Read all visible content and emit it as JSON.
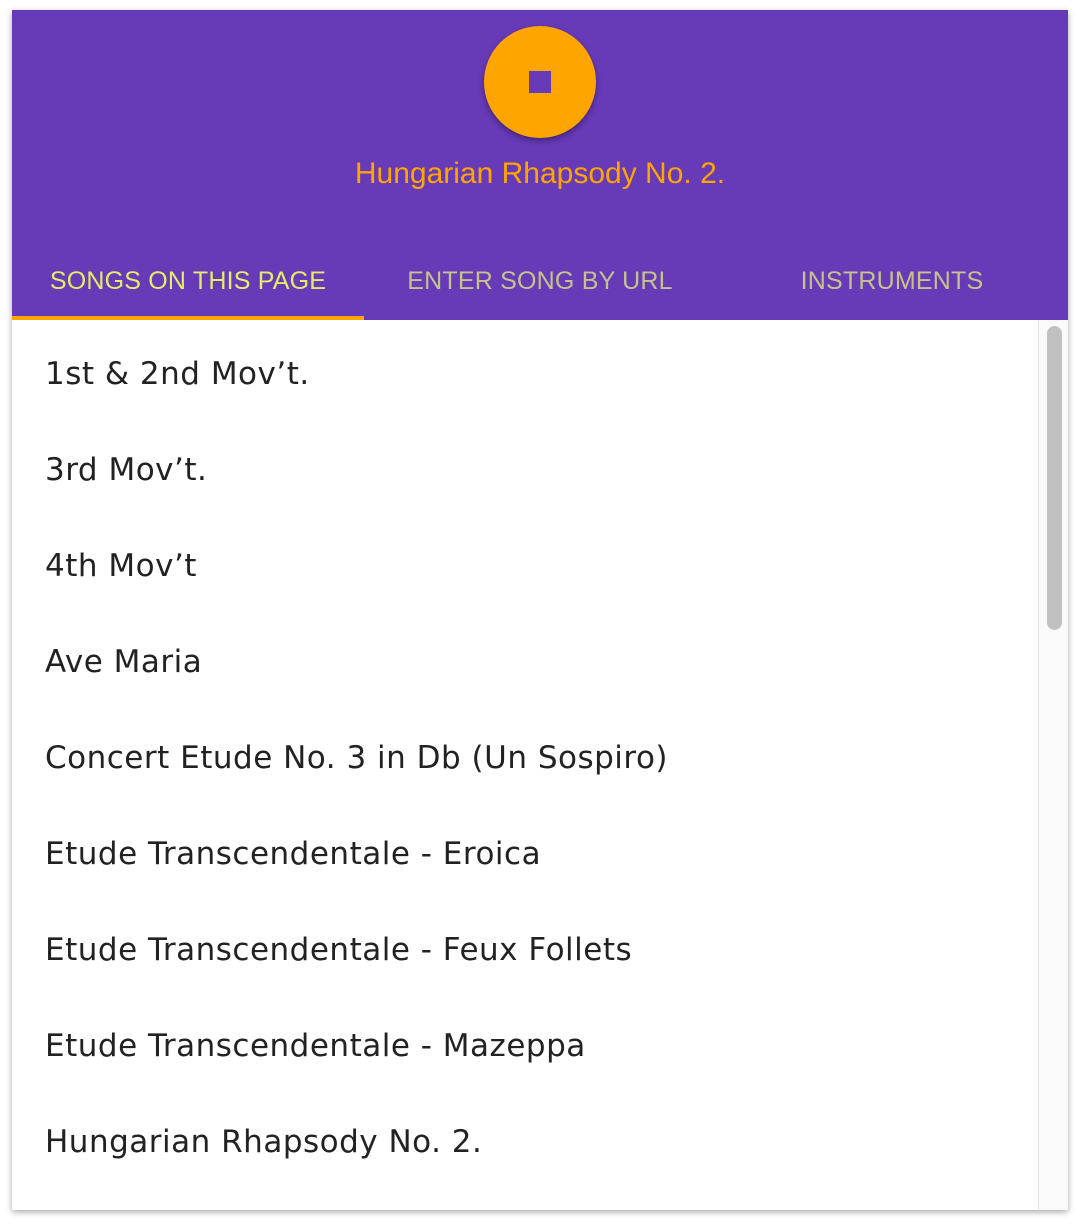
{
  "player": {
    "button_icon": "stop-icon",
    "now_playing": "Hungarian Rhapsody No. 2."
  },
  "tabs": [
    {
      "label": "SONGS ON THIS PAGE",
      "active": true
    },
    {
      "label": "ENTER SONG BY URL",
      "active": false
    },
    {
      "label": "INSTRUMENTS",
      "active": false
    }
  ],
  "songs": [
    "1st & 2nd Mov’t.",
    "3rd Mov’t.",
    "4th Mov’t",
    "Ave Maria",
    "Concert Etude No. 3 in Db (Un Sospiro)",
    "Etude Transcendentale - Eroica",
    "Etude Transcendentale - Feux Follets",
    "Etude Transcendentale - Mazeppa",
    "Hungarian Rhapsody No. 2."
  ],
  "colors": {
    "header": "#673ab7",
    "accent": "#ffa500",
    "tab_active_text": "#e4ec6a",
    "tab_inactive_text": "#c5c28c"
  }
}
